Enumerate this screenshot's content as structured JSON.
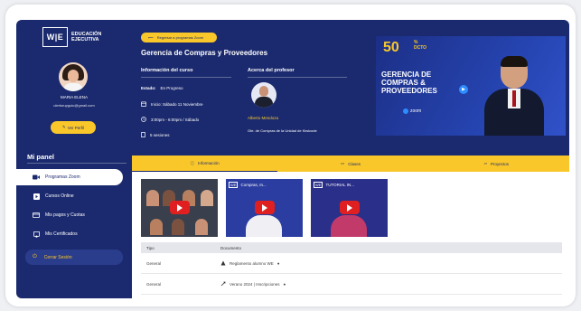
{
  "sidebar": {
    "logo_mark": "W|E",
    "logo_text_1": "EDUCACIÓN",
    "logo_text_2": "EJECUTIVA",
    "user_name": "MARIA ELENA",
    "user_email": "ulertsrupguiu@gmail.com",
    "edit_label": "Ver Perfil",
    "panel_title": "Mi panel",
    "items": [
      {
        "label": "Programas Zoom",
        "icon": "video-icon",
        "active": true
      },
      {
        "label": "Cursos Online",
        "icon": "play-icon",
        "active": false
      },
      {
        "label": "Mis pagos y Cuotas",
        "icon": "card-icon",
        "active": false
      },
      {
        "label": "Mis Certificados",
        "icon": "certificate-icon",
        "active": false
      }
    ],
    "logout_label": "Cerrar Sesión"
  },
  "hero": {
    "back_label": "Regresar a programas Zoom",
    "course_title": "Gerencia de Compras y Proveedores",
    "info_heading": "Información del curso",
    "status_label": "Estado:",
    "status_value": "En Progreso",
    "start": "Inicio: Sábado 11 Noviembre",
    "time": "3:00pm - 6:00pm / Sábado",
    "sessions": "5 sesiones",
    "prof_heading": "Acerca del profesor",
    "prof_name": "Alberto Mendoza",
    "prof_desc": "Gte. de Compras de la Unidad de Kiwicode"
  },
  "banner": {
    "percent": "50",
    "percent_sign": "%",
    "dcto": "DCTO",
    "title_1": "GERENCIA DE",
    "title_2": "COMPRAS &",
    "title_3": "PROVEEDORES",
    "zoom": "zoom"
  },
  "tabs": [
    {
      "label": "Información",
      "icon": "info-icon"
    },
    {
      "label": "Clases",
      "icon": "monitor-icon"
    },
    {
      "label": "Proyectos",
      "icon": "folder-icon"
    }
  ],
  "videos": [
    {
      "caption": ""
    },
    {
      "caption": "Compras, In..."
    },
    {
      "caption": "TUTORIAL IN..."
    }
  ],
  "table": {
    "col_1": "Tipo",
    "col_2": "Documento",
    "rows": [
      {
        "type": "General",
        "doc": "Reglamento alumno WE"
      },
      {
        "type": "General",
        "doc": "Verano 2024 | Inscripciones"
      }
    ]
  },
  "colors": {
    "navy": "#1b2a6e",
    "yellow": "#f9c72a",
    "zoom_blue": "#2d8cff"
  }
}
